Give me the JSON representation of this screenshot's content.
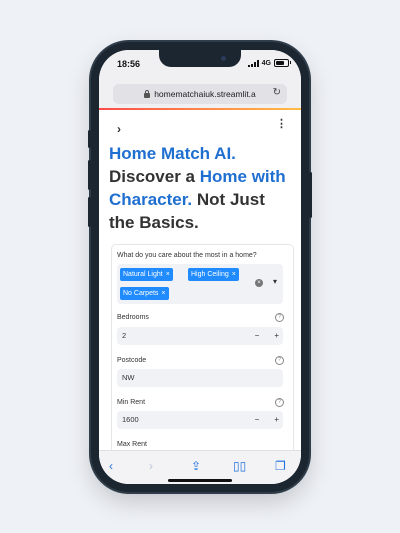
{
  "status": {
    "time": "18:56",
    "network": "4G"
  },
  "browser": {
    "url": "homematchaiuk.streamlit.a"
  },
  "app": {
    "title_part1": "Home Match AI.",
    "title_part2": "Discover a ",
    "title_part3": "Home with Character.",
    "title_part4": " Not Just the Basics."
  },
  "form": {
    "question_label": "What do you care about the most in a home?",
    "tags": [
      {
        "label": "Natural Light"
      },
      {
        "label": "High Ceiling"
      },
      {
        "label": "No Carpets"
      }
    ],
    "bedrooms": {
      "label": "Bedrooms",
      "value": "2"
    },
    "postcode": {
      "label": "Postcode",
      "value": "NW"
    },
    "min_rent": {
      "label": "Min Rent",
      "value": "1600"
    },
    "max_rent": {
      "label": "Max Rent"
    }
  },
  "icons": {
    "close": "×",
    "minus": "−",
    "plus": "+",
    "chevron_right": "›",
    "kebab": "⋮",
    "help": "?"
  },
  "colors": {
    "accent": "#1f6fd1",
    "tag": "#1f8bff",
    "streamlit_red": "#ff4b4b"
  }
}
